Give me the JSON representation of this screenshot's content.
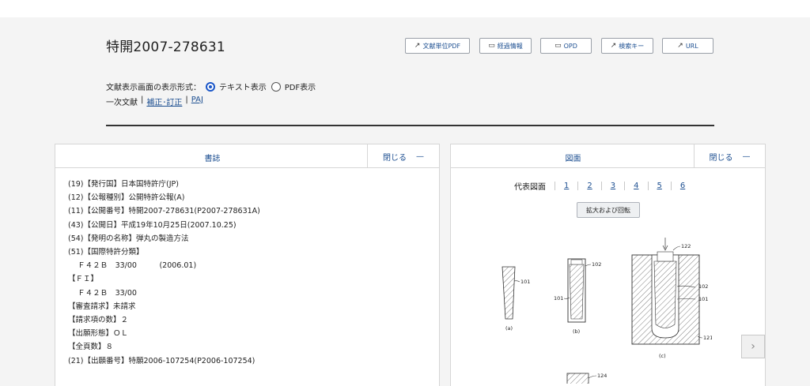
{
  "document": {
    "title": "特開2007-278631"
  },
  "toolbar": {
    "buttons": [
      {
        "label": "文献単位PDF",
        "icon": "external-link-icon"
      },
      {
        "label": "経過情報",
        "icon": "document-icon"
      },
      {
        "label": "OPD",
        "icon": "document-icon"
      },
      {
        "label": "検索キー",
        "icon": "external-link-icon"
      },
      {
        "label": "URL",
        "icon": "external-link-icon"
      }
    ]
  },
  "display_mode": {
    "label": "文献表示画面の表示形式：",
    "options": [
      {
        "label": "テキスト表示",
        "selected": true
      },
      {
        "label": "PDF表示",
        "selected": false
      }
    ]
  },
  "subdocs": {
    "primary": "一次文献",
    "separator": "|",
    "links": [
      "補正･訂正",
      "PAJ"
    ]
  },
  "biblio_panel": {
    "title": "書誌",
    "close_label": "閉じる",
    "collapse_symbol": "—",
    "lines": [
      "(19)【発行国】日本国特許庁(JP)",
      "(12)【公報種別】公開特許公報(A)",
      "(11)【公開番号】特開2007-278631(P2007-278631A)",
      "(43)【公開日】平成19年10月25日(2007.10.25)",
      "(54)【発明の名称】弾丸の製造方法",
      "(51)【国際特許分類】",
      "    Ｆ４２Ｂ　33/00　　　(2006.01)",
      "【ＦＩ】",
      "    Ｆ４２Ｂ　33/00",
      "【審査請求】未請求",
      "【請求項の数】２",
      "【出願形態】ＯＬ",
      "【全頁数】８",
      "(21)【出願番号】特願2006-107254(P2006-107254)"
    ]
  },
  "figure_panel": {
    "title": "図面",
    "close_label": "閉じる",
    "collapse_symbol": "—",
    "representative_label": "代表図面",
    "page_links": [
      "1",
      "2",
      "3",
      "4",
      "5",
      "6"
    ],
    "zoom_button": "拡大および回転",
    "figure_labels": {
      "a": "(a)",
      "b": "(b)",
      "c": "(c)",
      "n101": "101",
      "n102": "102",
      "n121": "121",
      "n122": "122",
      "n124": "124"
    }
  },
  "navigation": {
    "next_symbol": "›"
  }
}
